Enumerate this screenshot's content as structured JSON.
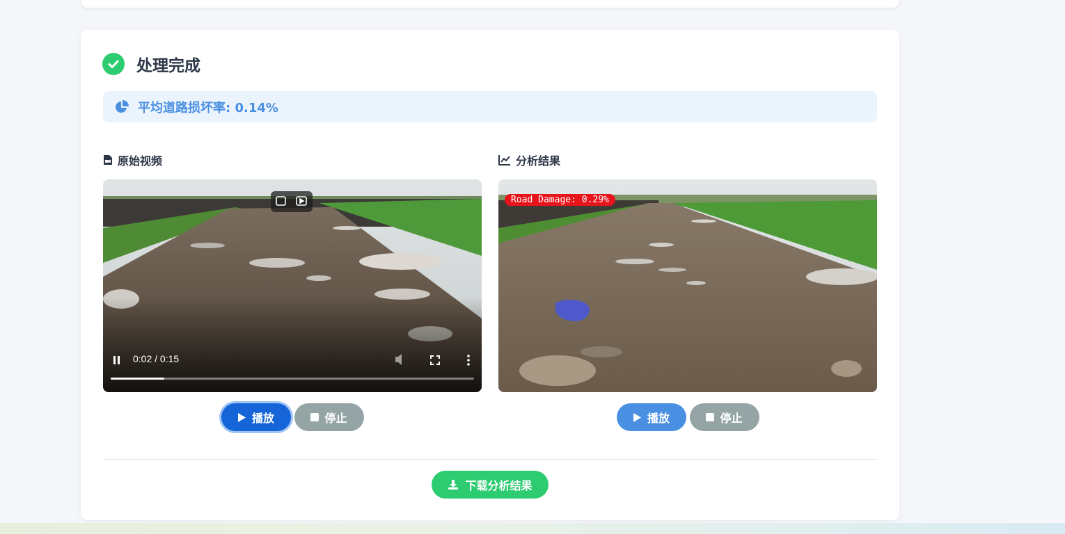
{
  "result": {
    "title": "处理完成",
    "stat_label": "平均道路损坏率: 0.14%"
  },
  "original": {
    "heading": "原始视频",
    "time": "0:02 / 0:15",
    "progress": 0.14,
    "play_label": "播放",
    "stop_label": "停止"
  },
  "analysis": {
    "heading": "分析结果",
    "overlay": "Road Damage: 0.29%",
    "play_label": "播放",
    "stop_label": "停止"
  },
  "download_label": "下载分析结果",
  "colors": {
    "success": "#2ecc71",
    "primary": "#4a90e2",
    "primary_active": "#1565d8",
    "muted": "#95a5a6",
    "damage": "#e8141c"
  }
}
